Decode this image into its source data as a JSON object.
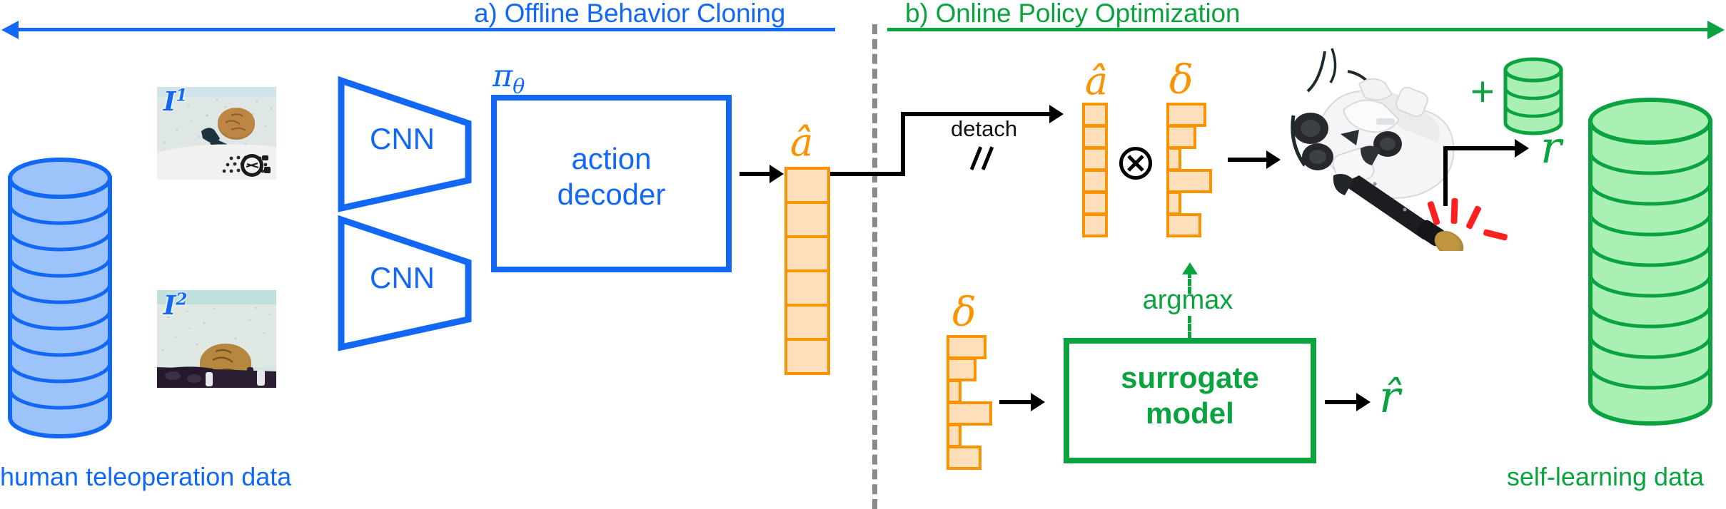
{
  "figure": {
    "type": "pipeline-diagram",
    "caption_a": "a) Offline Behavior Cloning",
    "caption_b": "b) Online Policy Optimization"
  },
  "colors": {
    "blue": "#1268f5",
    "green": "#0aa33f",
    "orange": "#fb9200",
    "orange_fill": "#fde0bb",
    "cyl_blue_fill": "#9dc3fb",
    "cyl_green_fill": "#aaf0b5",
    "divider_gray": "#8a8a8a",
    "spark_red": "#fc2020",
    "black": "#000000"
  },
  "offline": {
    "title": "a) Offline Behavior Cloning",
    "dataset_label": "human teleoperation data",
    "dataset_discs": 9,
    "images": [
      {
        "label": "I",
        "superscript": "1",
        "name": "camera-view-1"
      },
      {
        "label": "I",
        "superscript": "2",
        "name": "camera-view-2"
      }
    ],
    "encoders": [
      {
        "label": "CNN"
      },
      {
        "label": "CNN"
      }
    ],
    "policy": {
      "symbol": "π",
      "subscript": "θ",
      "box_line1": "action",
      "box_line2": "decoder"
    },
    "output_vector": {
      "symbol": "â",
      "cells": 6
    }
  },
  "online": {
    "title": "b) Online Policy Optimization",
    "detach_label": "detach",
    "action_vector": {
      "symbol": "â",
      "cells": 6
    },
    "delta_vector_top": {
      "symbol": "δ",
      "cells": 6,
      "widths": [
        76,
        58,
        26,
        86,
        26,
        66
      ]
    },
    "delta_vector_bottom": {
      "symbol": "δ",
      "cells": 6,
      "widths": [
        76,
        58,
        26,
        86,
        26,
        66
      ]
    },
    "operator": {
      "symbol": "⊗",
      "name": "tensor-product"
    },
    "robot": {
      "name": "underwater-manipulator-robot"
    },
    "surrogate": {
      "box_line1": "surrogate",
      "box_line2": "model",
      "output_symbol": "r̂"
    },
    "argmax_label": "argmax",
    "reward_symbol": "r",
    "plus_symbol": "+",
    "buffer_discs": 3,
    "dataset_label": "self-learning data",
    "dataset_discs": 9
  }
}
